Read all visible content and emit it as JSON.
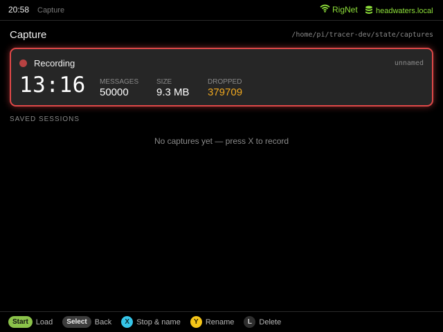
{
  "status_bar": {
    "time": "20:58",
    "breadcrumb": "Capture",
    "network_name": "RigNet",
    "host_name": "headwaters.local",
    "icons": {
      "network": "wifi-icon",
      "host": "database-icon"
    },
    "accent_color": "#8ee03a"
  },
  "page": {
    "title": "Capture",
    "path": "/home/pi/tracer-dev/state/captures"
  },
  "recording": {
    "status_label": "Recording",
    "session_name": "unnamed",
    "elapsed": "13:16",
    "stats": [
      {
        "label": "MESSAGES",
        "value": "50000"
      },
      {
        "label": "SIZE",
        "value": "9.3 MB"
      },
      {
        "label": "DROPPED",
        "value": "379709"
      }
    ],
    "border_color": "#e04848",
    "warning_color": "#f0a81f"
  },
  "saved_sessions": {
    "heading": "SAVED SESSIONS",
    "empty_message": "No captures yet — press X to record"
  },
  "controls": [
    {
      "button": "Start",
      "action": "Load",
      "color": "#8bc34a"
    },
    {
      "button": "Select",
      "action": "Back",
      "color": "#3d3d3d"
    },
    {
      "button": "X",
      "action": "Stop & name",
      "color": "#36c5e8"
    },
    {
      "button": "Y",
      "action": "Rename",
      "color": "#f5c518"
    },
    {
      "button": "L",
      "action": "Delete",
      "color": "#2e2e2e"
    }
  ]
}
